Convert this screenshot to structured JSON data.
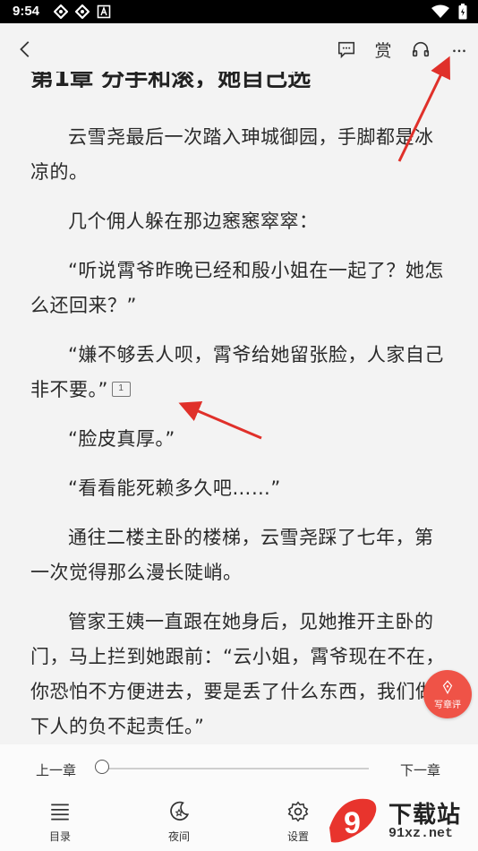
{
  "status_bar": {
    "time": "9:54"
  },
  "toolbar": {
    "reward_label": "赏"
  },
  "chapter_title": "第1章 分手和滚，她自己选",
  "paragraphs": [
    {
      "text": "云雪尧最后一次踏入珅城御园，手脚都是冰凉的。"
    },
    {
      "text": "几个佣人躲在那边窸窸窣窣："
    },
    {
      "text": "“听说霄爷昨晚已经和殷小姐在一起了？她怎么还回来？”"
    },
    {
      "text": "“嫌不够丢人呗，霄爷给她留张脸，人家自己非不要。”",
      "comment_count": "1"
    },
    {
      "text": "“脸皮真厚。”"
    },
    {
      "text": "“看看能死赖多久吧……”"
    },
    {
      "text": "通往二楼主卧的楼梯，云雪尧踩了七年，第一次觉得那么漫长陡峭。"
    },
    {
      "text": "管家王姨一直跟在她身后，见她推开主卧的门，马上拦到她跟前：“云小姐，霄爷现在不在，你恐怕不方便进去，要是丢了什么东西，我们做下人的负不起责任。”"
    }
  ],
  "write_review_label": "写章评",
  "bottom": {
    "prev_chapter": "上一章",
    "next_chapter": "下一章",
    "progress": 0,
    "menu": [
      {
        "label": "目录",
        "icon": "list-icon"
      },
      {
        "label": "夜间",
        "icon": "moon-icon"
      },
      {
        "label": "设置",
        "icon": "gear-icon"
      }
    ]
  },
  "watermark": {
    "cn": "下载站",
    "en": "91xz.net",
    "digit": "9"
  },
  "colors": {
    "accent": "#ef5347",
    "arrow": "#e0302a",
    "background": "#f3f3f3"
  }
}
